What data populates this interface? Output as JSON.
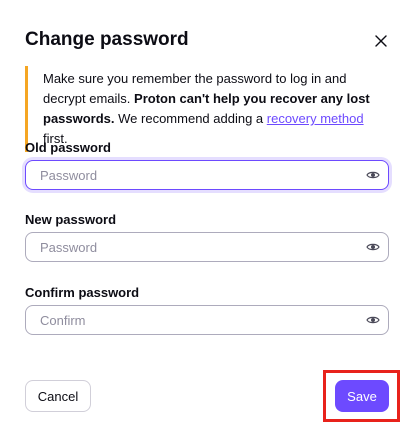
{
  "dialog": {
    "title": "Change password",
    "close_icon": "close-icon"
  },
  "notice": {
    "text_before": "Make sure you remember the password to log in and decrypt emails. ",
    "bold_text": "Proton can't help you recover any lost passwords.",
    "text_middle": " We recommend adding a ",
    "link_text": "recovery method",
    "text_after": " first.",
    "accent_color": "#f5a623"
  },
  "fields": {
    "old_password": {
      "label": "Old password",
      "placeholder": "Password",
      "value": "",
      "icon": "eye-icon"
    },
    "new_password": {
      "label": "New password",
      "placeholder": "Password",
      "value": "",
      "icon": "eye-icon"
    },
    "confirm_password": {
      "label": "Confirm password",
      "placeholder": "Confirm",
      "value": "",
      "icon": "eye-icon"
    }
  },
  "buttons": {
    "cancel_label": "Cancel",
    "save_label": "Save"
  },
  "colors": {
    "brand": "#6d4aff",
    "highlight_box": "#e8221b"
  }
}
